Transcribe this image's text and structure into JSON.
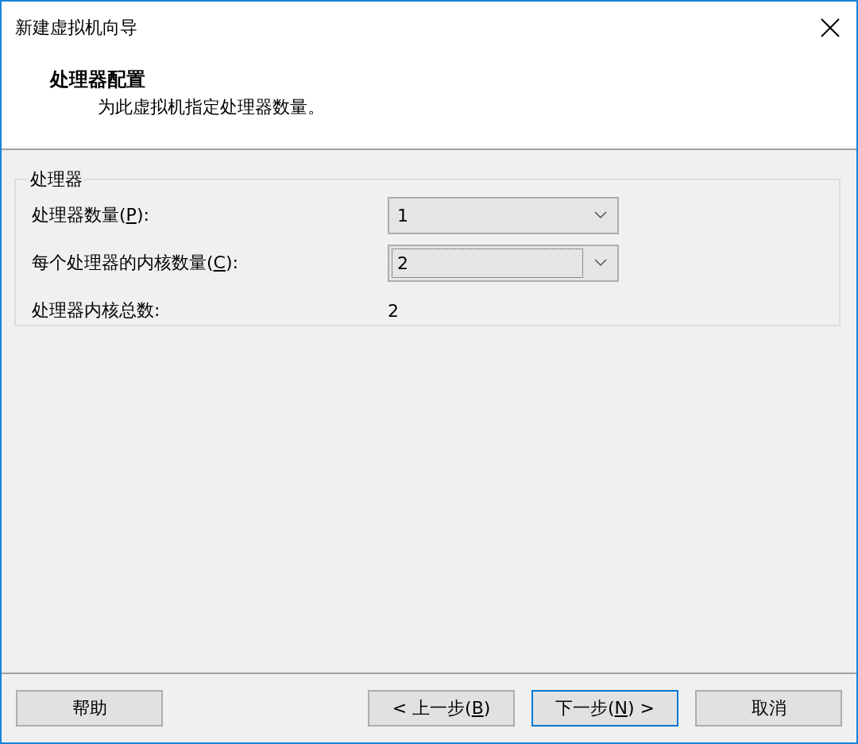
{
  "window": {
    "title": "新建虚拟机向导"
  },
  "header": {
    "title": "处理器配置",
    "subtitle": "为此虚拟机指定处理器数量。"
  },
  "group": {
    "legend": "处理器",
    "fields": [
      {
        "kind": "combo",
        "label": {
          "before": "处理器数量(",
          "key": "P",
          "after": "):"
        },
        "value": "1",
        "focused": false
      },
      {
        "kind": "combo",
        "label": {
          "before": "每个处理器的内核数量(",
          "key": "C",
          "after": "):"
        },
        "value": "2",
        "focused": true
      },
      {
        "kind": "readout",
        "label": {
          "before": "处理器内核总数:"
        },
        "value": "2"
      }
    ]
  },
  "buttons": [
    {
      "label": {
        "before": "帮助"
      },
      "default": false
    },
    {
      "label": {
        "before": "< 上一步(",
        "key": "B",
        "after": ")"
      },
      "default": false
    },
    {
      "label": {
        "before": "下一步(",
        "key": "N",
        "after": ") >"
      },
      "default": true
    },
    {
      "label": {
        "before": "取消"
      },
      "default": false
    }
  ]
}
